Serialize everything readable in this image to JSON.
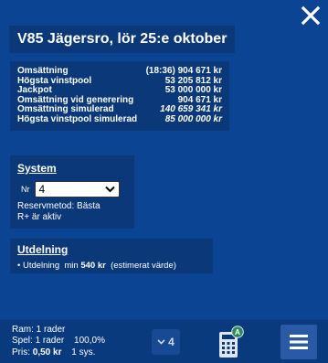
{
  "header": {
    "title": "V85 Jägersro, lör 25:e oktober",
    "close_icon": "close-icon"
  },
  "stats": [
    {
      "label": "Omsättning",
      "value": "(18:36) 904 671 kr",
      "italic": false
    },
    {
      "label": "Högsta vinstpool",
      "value": "53 205 812 kr",
      "italic": false
    },
    {
      "label": "Jackpot",
      "value": "53 000 000 kr",
      "italic": false
    },
    {
      "label": "Omsättning vid generering",
      "value": "904 671 kr",
      "italic": false
    },
    {
      "label": "Omsättning simulerad",
      "value": "140 659 341 kr",
      "italic": true
    },
    {
      "label": "Högsta vinstpool simulerad",
      "value": "85 000 000 kr",
      "italic": true
    }
  ],
  "system": {
    "title": "System",
    "nr_label": "Nr",
    "nr_value": "4",
    "reserve_method": "Reservmetod: Bästa",
    "r_plus": "R+ är aktiv"
  },
  "payout": {
    "title": "Utdelning",
    "bullet": "•",
    "line_prefix": "Utdelning",
    "min_label": "min",
    "amount": "540 kr",
    "note": "(estimerat värde)"
  },
  "footer": {
    "ram": "Ram: 1 rader",
    "spel": "Spel: 1 rader",
    "spel_pct": "100,0%",
    "pris_label": "Pris:",
    "pris_value": "0,50 kr",
    "pris_sys": "1 sys.",
    "count_value": "4",
    "calc_badge": "A",
    "menu_icon": "hamburger-menu-icon"
  },
  "colors": {
    "background": "#0c4494",
    "panel": "#0a3878",
    "footer": "#0a3a7e",
    "menu_button": "#2a5aa5",
    "badge": "#2e8b57"
  }
}
